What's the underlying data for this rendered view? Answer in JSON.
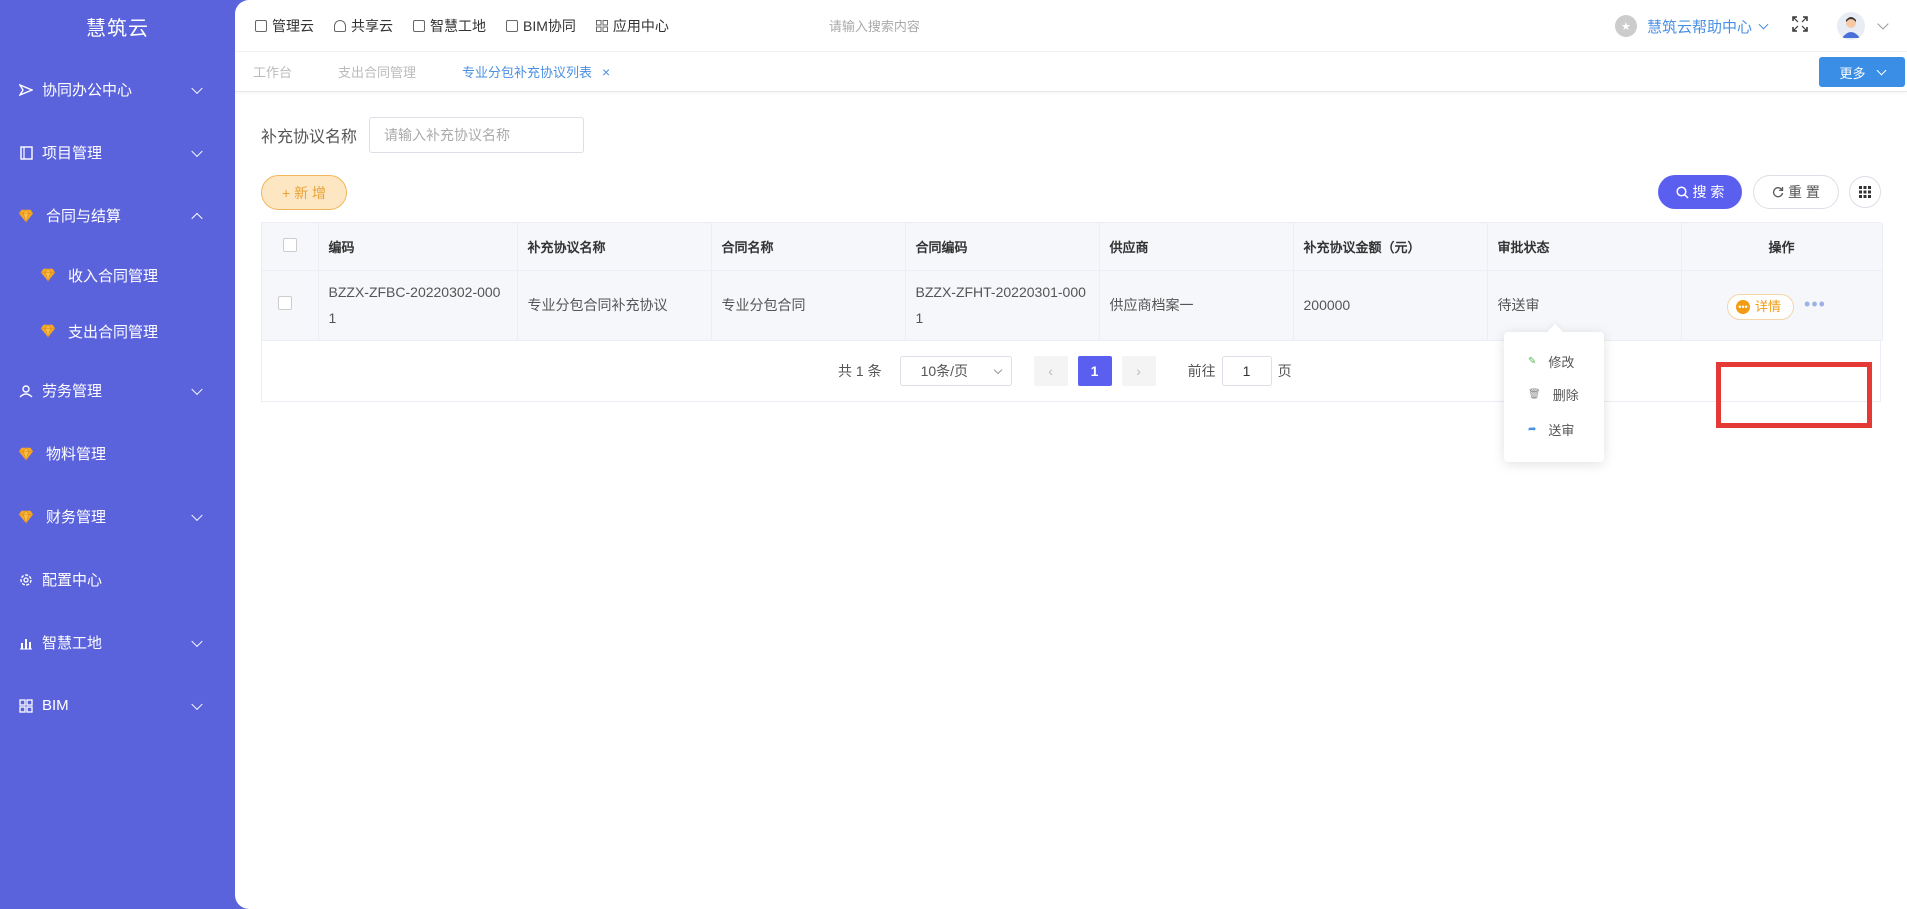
{
  "brand": "慧筑云",
  "sidebar": {
    "items": [
      {
        "label": "协同办公中心",
        "icon": "send-icon",
        "chevron": "down"
      },
      {
        "label": "项目管理",
        "icon": "book-icon",
        "chevron": "down"
      },
      {
        "label": "合同与结算",
        "icon": "gem-icon",
        "chevron": "up",
        "children": [
          {
            "label": "收入合同管理",
            "icon": "gem-icon"
          },
          {
            "label": "支出合同管理",
            "icon": "gem-icon"
          }
        ]
      },
      {
        "label": "劳务管理",
        "icon": "user-icon",
        "chevron": "down"
      },
      {
        "label": "物料管理",
        "icon": "gem-icon"
      },
      {
        "label": "财务管理",
        "icon": "gem-icon",
        "chevron": "down"
      },
      {
        "label": "配置中心",
        "icon": "gear-icon"
      },
      {
        "label": "智慧工地",
        "icon": "bar-chart-icon",
        "chevron": "down"
      },
      {
        "label": "BIM",
        "icon": "grid-icon",
        "chevron": "down"
      }
    ]
  },
  "topnav": {
    "links": [
      "管理云",
      "共享云",
      "智慧工地",
      "BIM协同",
      "应用中心"
    ],
    "search_placeholder": "请输入搜索内容",
    "help_label": "慧筑云帮助中心"
  },
  "tabs": {
    "items": [
      "工作台",
      "支出合同管理",
      "专业分包补充协议列表"
    ],
    "close": "×",
    "more_label": "更多"
  },
  "filter": {
    "label": "补充协议名称",
    "placeholder": "请输入补充协议名称"
  },
  "actions": {
    "add_label": "新 增",
    "search_label": "搜 索",
    "reset_label": "重 置"
  },
  "table": {
    "headers": [
      "编码",
      "补充协议名称",
      "合同名称",
      "合同编码",
      "供应商",
      "补充协议金额（元）",
      "审批状态",
      "操作"
    ],
    "rows": [
      {
        "code": "BZZX-ZFBC-20220302-0001",
        "name": "专业分包合同补充协议",
        "contract_name": "专业分包合同",
        "contract_code": "BZZX-ZFHT-20220301-0001",
        "supplier": "供应商档案一",
        "amount": "200000",
        "status": "待送审",
        "detail_label": "详情"
      }
    ]
  },
  "pager": {
    "total": "共 1 条",
    "page_size": "10条/页",
    "current_page": "1",
    "goto_prefix": "前往",
    "goto_value": "1",
    "goto_suffix": "页"
  },
  "dropdown": {
    "items": [
      "修改",
      "删除",
      "送审"
    ]
  },
  "colors": {
    "sidebar": "#5b63dc",
    "primary": "#5b5ff0",
    "accent_blue": "#3a8ee6",
    "warning": "#f39c12",
    "highlight": "#e53935"
  }
}
